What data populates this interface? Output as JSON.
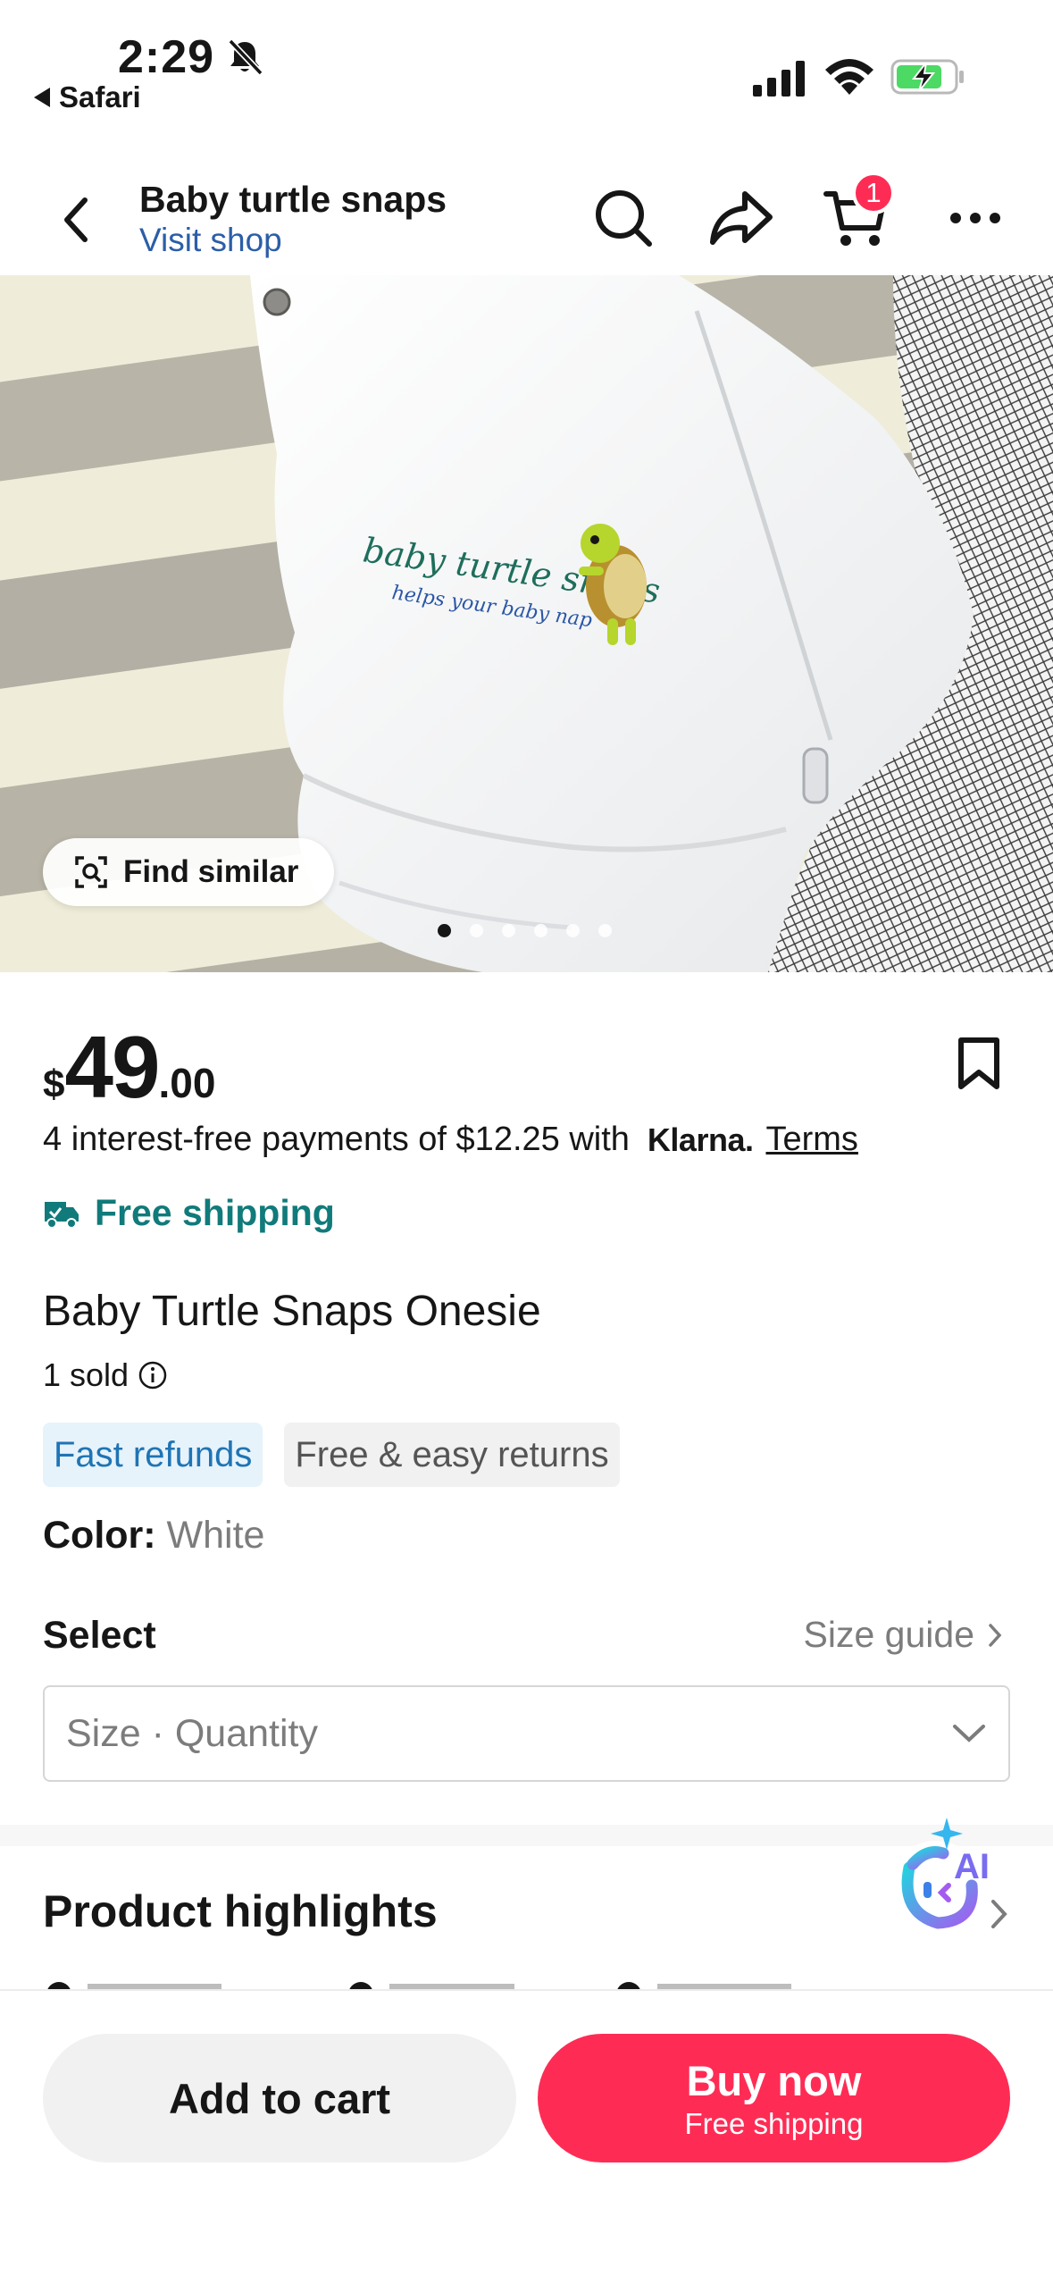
{
  "status_bar": {
    "time": "2:29",
    "back_app": "Safari"
  },
  "header": {
    "title": "Baby turtle snaps",
    "subtitle": "Visit shop",
    "cart_count": "1"
  },
  "image": {
    "find_similar": "Find similar",
    "print_line1": "baby turtle snaps",
    "print_line2": "helps your baby nap",
    "carousel_count": 6,
    "carousel_active_index": 0
  },
  "price": {
    "currency": "$",
    "whole": "49",
    "cents": ".00"
  },
  "klarna": {
    "text": "4 interest-free payments of $12.25 with",
    "brand": "Klarna.",
    "terms": "Terms"
  },
  "shipping": {
    "label": "Free shipping"
  },
  "product": {
    "title": "Baby Turtle Snaps Onesie",
    "sold": "1 sold"
  },
  "badges": [
    "Fast refunds",
    "Free & easy returns"
  ],
  "color": {
    "label": "Color:",
    "value": "White"
  },
  "select": {
    "label": "Select",
    "size_guide": "Size guide",
    "dropdown_placeholder": "Size · Quantity"
  },
  "highlights": {
    "title": "Product highlights"
  },
  "ai": {
    "label": "AI"
  },
  "actions": {
    "add_to_cart": "Add to cart",
    "buy_now": "Buy now",
    "buy_now_sub": "Free shipping"
  },
  "colors": {
    "accent_red": "#fe2c55",
    "link_blue": "#2b5ea8",
    "teal": "#117a7a",
    "badge_blue_bg": "#e6f3fb",
    "battery_green": "#4cd964"
  }
}
